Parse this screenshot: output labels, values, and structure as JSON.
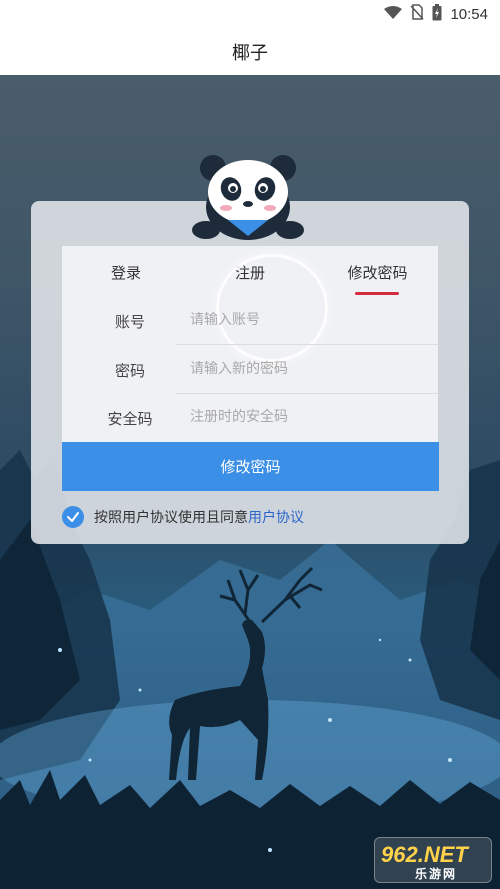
{
  "status_bar": {
    "time": "10:54",
    "icons": [
      "wifi-icon",
      "no-sim-icon",
      "battery-icon"
    ]
  },
  "header": {
    "title": "椰子"
  },
  "tabs": [
    {
      "label": "登录",
      "active": false
    },
    {
      "label": "注册",
      "active": false
    },
    {
      "label": "修改密码",
      "active": true
    }
  ],
  "form": {
    "account": {
      "label": "账号",
      "placeholder": "请输入账号"
    },
    "password": {
      "label": "密码",
      "placeholder": "请输入新的密码"
    },
    "security": {
      "label": "安全码",
      "placeholder": "注册时的安全码"
    },
    "submit_label": "修改密码"
  },
  "agreement": {
    "checked": true,
    "text": "按照用户协议使用且同意",
    "link": "用户协议"
  },
  "watermark": {
    "top": "962.NET",
    "bottom": "乐游网"
  },
  "colors": {
    "accent": "#3b8fe6",
    "tab_underline": "#d52b3e",
    "link": "#2c66c9"
  }
}
